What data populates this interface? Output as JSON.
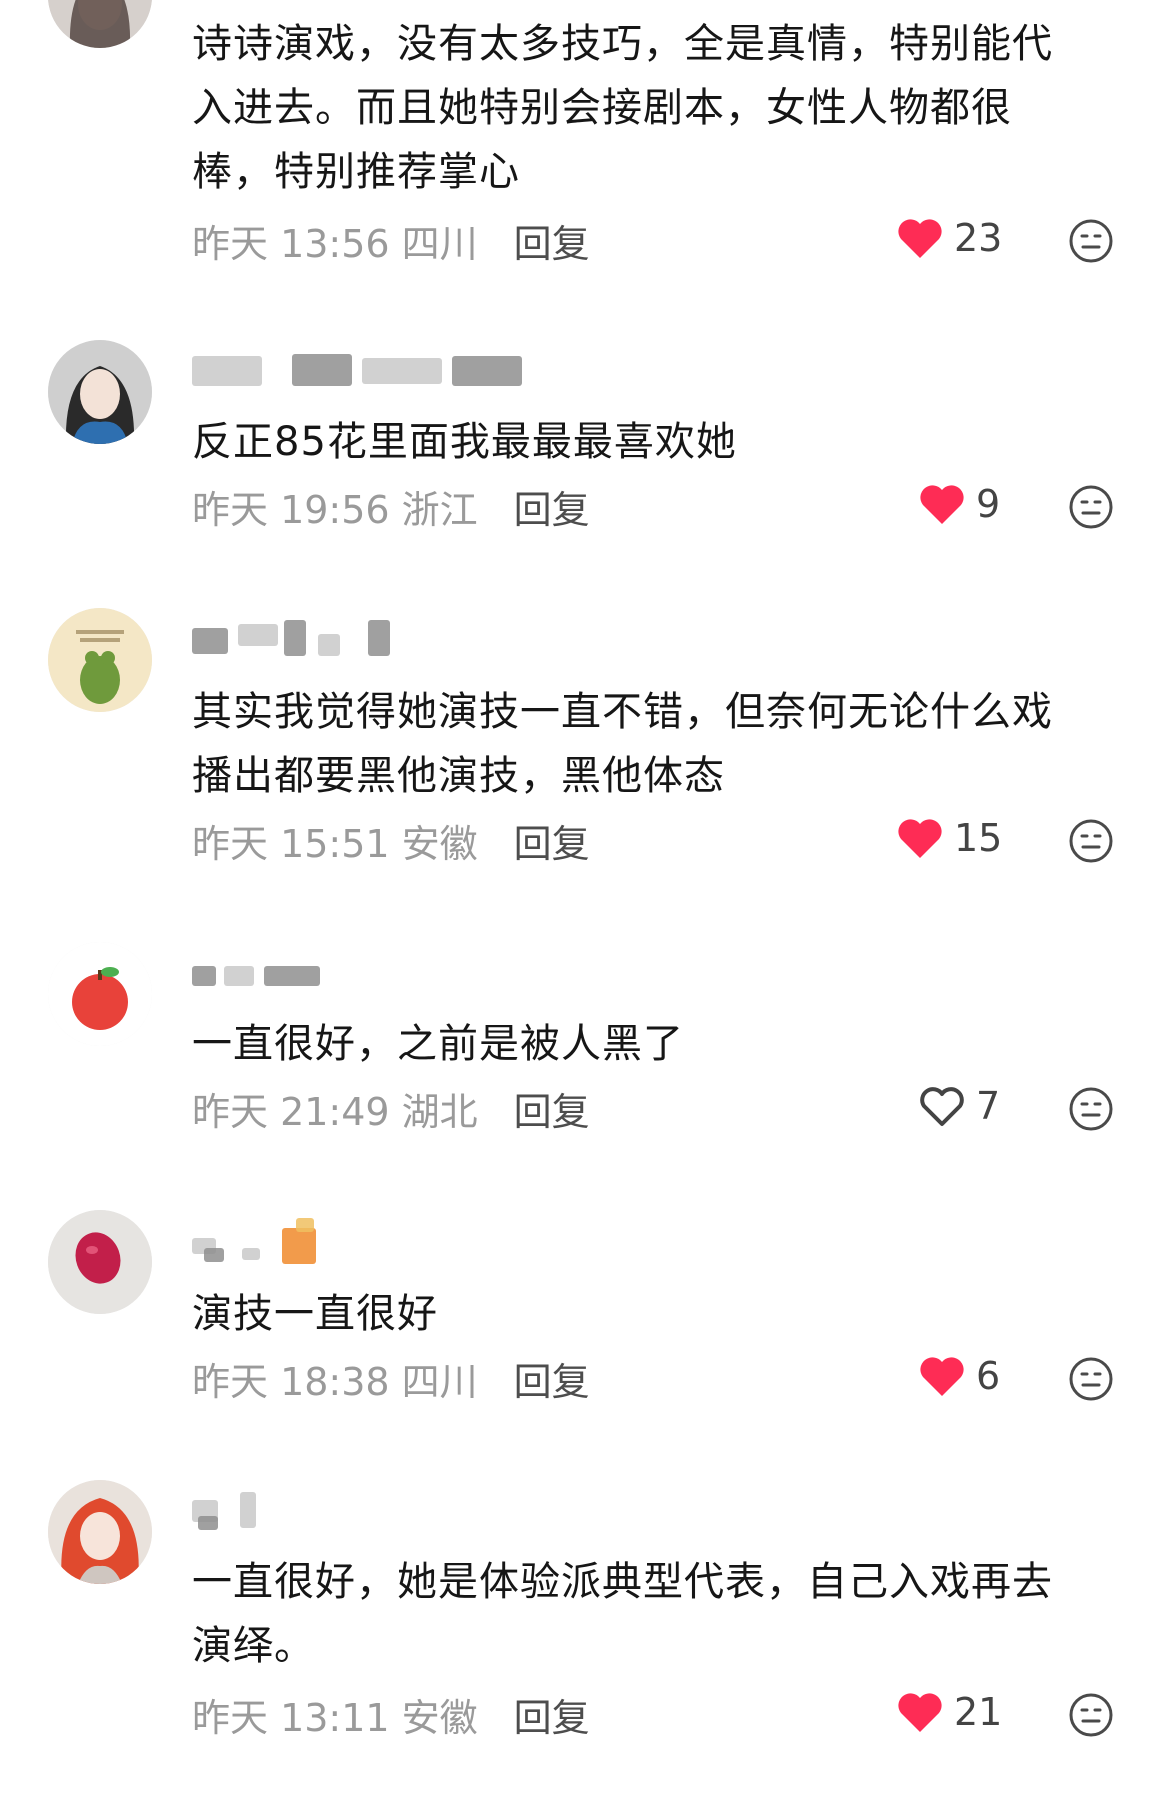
{
  "comments": [
    {
      "text": "诗诗演戏，没有太多技巧，全是真情，特别能代入进去。而且她特别会接剧本，女性人物都很棒，特别推荐掌心",
      "time": "昨天 13:56 四川",
      "reply": "回复",
      "likes": "23",
      "liked": true
    },
    {
      "text": "反正85花里面我最最最喜欢她",
      "time": "昨天 19:56 浙江",
      "reply": "回复",
      "likes": "9",
      "liked": true
    },
    {
      "text": "其实我觉得她演技一直不错，但奈何无论什么戏播出都要黑他演技，黑他体态",
      "time": "昨天 15:51 安徽",
      "reply": "回复",
      "likes": "15",
      "liked": true
    },
    {
      "text": "一直很好，之前是被人黑了",
      "time": "昨天 21:49 湖北",
      "reply": "回复",
      "likes": "7",
      "liked": false
    },
    {
      "text": "演技一直很好",
      "time": "昨天 18:38 四川",
      "reply": "回复",
      "likes": "6",
      "liked": true
    },
    {
      "text": "一直很好，她是体验派典型代表，自己入戏再去演绎。",
      "time": "昨天 13:11 安徽",
      "reply": "回复",
      "likes": "21",
      "liked": true
    }
  ],
  "colors": {
    "heart_liked": "#fe2c55",
    "heart_outline": "#444444",
    "meta_gray": "#9a9a9a",
    "reply_text": "#4d4d4d"
  },
  "icons": {
    "like": "heart-icon",
    "dislike": "neutral-face-icon"
  }
}
